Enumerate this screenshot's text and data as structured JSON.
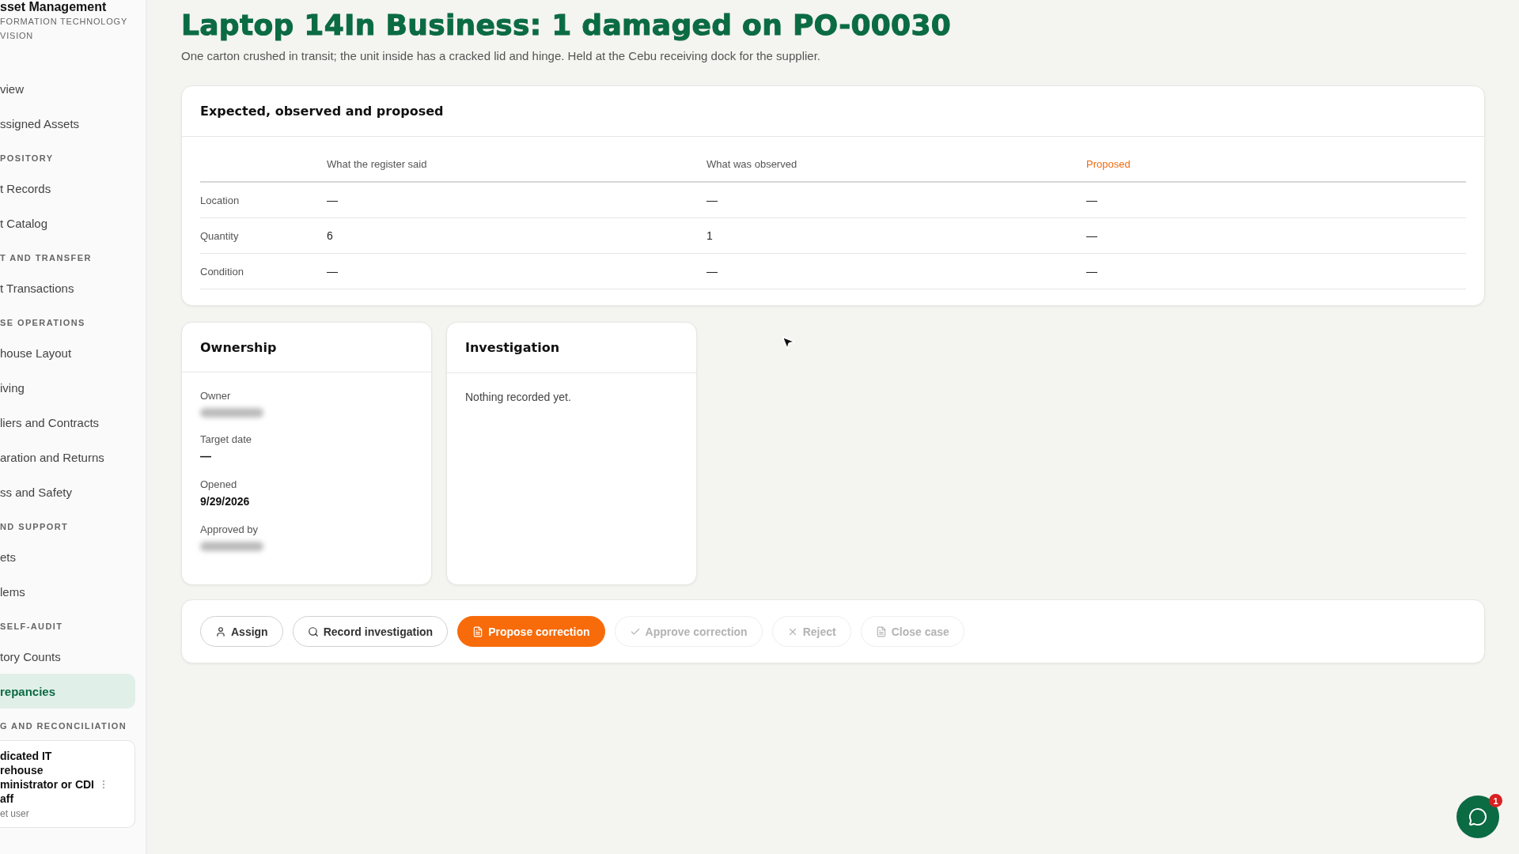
{
  "sidebar": {
    "brand": "sset Management",
    "org": "FORMATION TECHNOLOGY VISION",
    "groups": [
      {
        "items": [
          {
            "label": "view",
            "selected": false
          },
          {
            "label": "ssigned Assets",
            "selected": false
          }
        ]
      },
      {
        "heading": "POSITORY",
        "items": [
          {
            "label": "t Records",
            "selected": false
          },
          {
            "label": "t Catalog",
            "selected": false
          }
        ]
      },
      {
        "heading": "T AND TRANSFER",
        "items": [
          {
            "label": "t Transactions",
            "selected": false
          }
        ]
      },
      {
        "heading": "SE OPERATIONS",
        "items": [
          {
            "label": "house Layout",
            "selected": false
          },
          {
            "label": "iving",
            "selected": false
          },
          {
            "label": "liers and Contracts",
            "selected": false
          },
          {
            "label": "aration and Returns",
            "selected": false
          },
          {
            "label": "ss and Safety",
            "selected": false
          }
        ]
      },
      {
        "heading": "ND SUPPORT",
        "items": [
          {
            "label": "ets",
            "selected": false
          },
          {
            "label": "lems",
            "selected": false
          }
        ]
      },
      {
        "heading": "SELF-AUDIT",
        "items": [
          {
            "label": "tory Counts",
            "selected": false
          },
          {
            "label": "repancies",
            "selected": true
          }
        ]
      },
      {
        "heading": "G AND RECONCILIATION"
      }
    ],
    "user": {
      "name": "dicated IT rehouse ministrator or CDI aff",
      "role": "et user"
    }
  },
  "header": {
    "title": "Laptop 14In Business: 1 damaged on PO-00030",
    "subtitle": "One carton crushed in transit; the unit inside has a cracked lid and hinge. Held at the Cebu receiving dock for the supplier."
  },
  "comparison": {
    "title": "Expected, observed and proposed",
    "columns": [
      "What the register said",
      "What was observed",
      "Proposed"
    ],
    "rows": [
      {
        "label": "Location",
        "values": [
          "—",
          "—",
          "—"
        ]
      },
      {
        "label": "Quantity",
        "values": [
          "6",
          "1",
          "—"
        ]
      },
      {
        "label": "Condition",
        "values": [
          "—",
          "—",
          "—"
        ]
      }
    ]
  },
  "ownership": {
    "title": "Ownership",
    "fields": [
      {
        "label": "Owner",
        "redacted": true
      },
      {
        "label": "Target date",
        "value": "—"
      },
      {
        "label": "Opened",
        "value": "9/29/2026"
      },
      {
        "label": "Approved by",
        "redacted": true
      }
    ]
  },
  "investigation": {
    "title": "Investigation",
    "text": "Nothing recorded yet."
  },
  "actions": [
    {
      "label": "Assign",
      "kind": "outline",
      "disabled": false
    },
    {
      "label": "Record investigation",
      "kind": "outline",
      "disabled": false
    },
    {
      "label": "Propose correction",
      "kind": "primary",
      "disabled": false
    },
    {
      "label": "Approve correction",
      "kind": "outline",
      "disabled": true
    },
    {
      "label": "Reject",
      "kind": "outline",
      "disabled": true
    },
    {
      "label": "Close case",
      "kind": "outline",
      "disabled": true
    }
  ],
  "chat": {
    "badge": "1"
  }
}
